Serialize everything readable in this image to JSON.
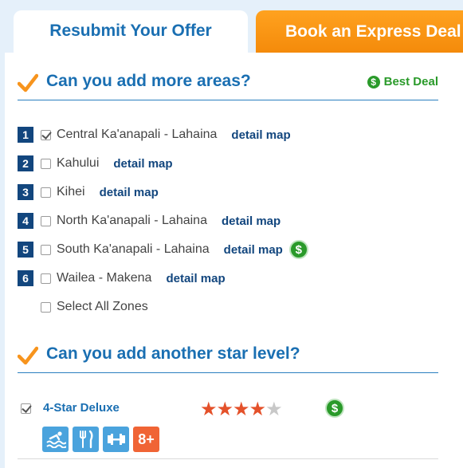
{
  "tabs": {
    "active_label": "Resubmit Your Offer",
    "other_label": "Book an Express Deal"
  },
  "areas_section": {
    "title": "Can you add more areas?",
    "best_deal_label": "Best Deal",
    "zones": [
      {
        "number": "1",
        "name": "Central Ka'anapali - Lahaina",
        "checked": true,
        "link": "detail map",
        "best_deal": false
      },
      {
        "number": "2",
        "name": "Kahului",
        "checked": false,
        "link": "detail map",
        "best_deal": false
      },
      {
        "number": "3",
        "name": "Kihei",
        "checked": false,
        "link": "detail map",
        "best_deal": false
      },
      {
        "number": "4",
        "name": "North Ka'anapali - Lahaina",
        "checked": false,
        "link": "detail map",
        "best_deal": false
      },
      {
        "number": "5",
        "name": "South Ka'anapali - Lahaina",
        "checked": false,
        "link": "detail map",
        "best_deal": true
      },
      {
        "number": "6",
        "name": "Wailea - Makena",
        "checked": false,
        "link": "detail map",
        "best_deal": false
      }
    ],
    "select_all_label": "Select All Zones"
  },
  "star_section": {
    "title": "Can you add another star level?",
    "level_label": "4-Star Deluxe",
    "level_checked": true,
    "star_rating": 4,
    "star_max": 5,
    "amenities": [
      "pool-icon",
      "restaurant-icon",
      "fitness-icon",
      "kids-8plus-icon"
    ],
    "kids_badge_text": "8+"
  },
  "icons": {
    "dollar_symbol": "$",
    "star_symbol": "★"
  },
  "colors": {
    "accent_blue": "#1a6fb2",
    "zone_badge": "#12467e",
    "tab_orange": "#f7941d",
    "deal_green": "#2a9a2a",
    "star_on": "#e4512a",
    "amenity_blue": "#4aa3dd",
    "kids_orange": "#f06435"
  }
}
